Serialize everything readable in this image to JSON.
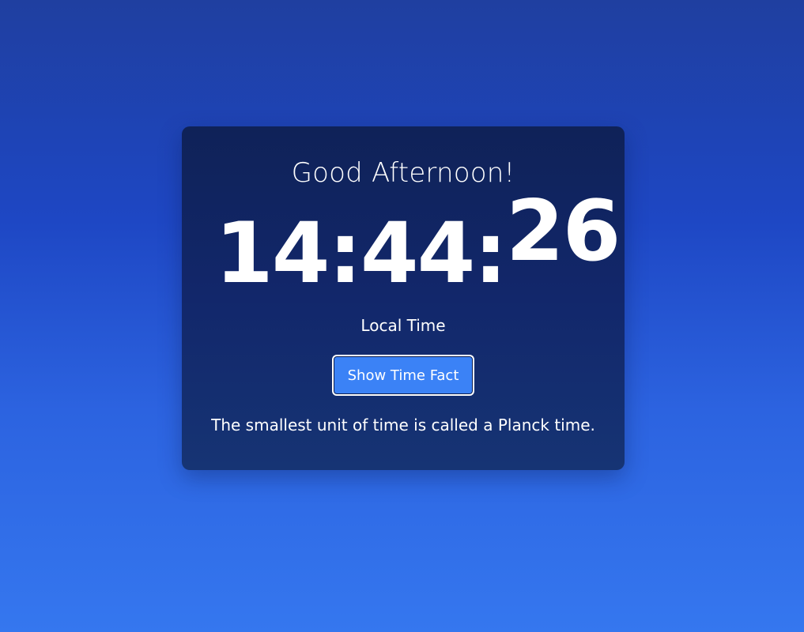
{
  "greeting": "Good Afternoon!",
  "clock": {
    "hours": "14",
    "minutes": "44",
    "seconds": "26",
    "separator": ":"
  },
  "timezone_label": "Local Time",
  "fact_button": {
    "label": "Show Time Fact"
  },
  "fact_text": "The smallest unit of time is called a Planck time.",
  "colors": {
    "background_top": "#1f3fa0",
    "background_bottom": "#3577ef",
    "card": "#12276b",
    "button": "#3b82f6",
    "text": "#ffffff"
  }
}
